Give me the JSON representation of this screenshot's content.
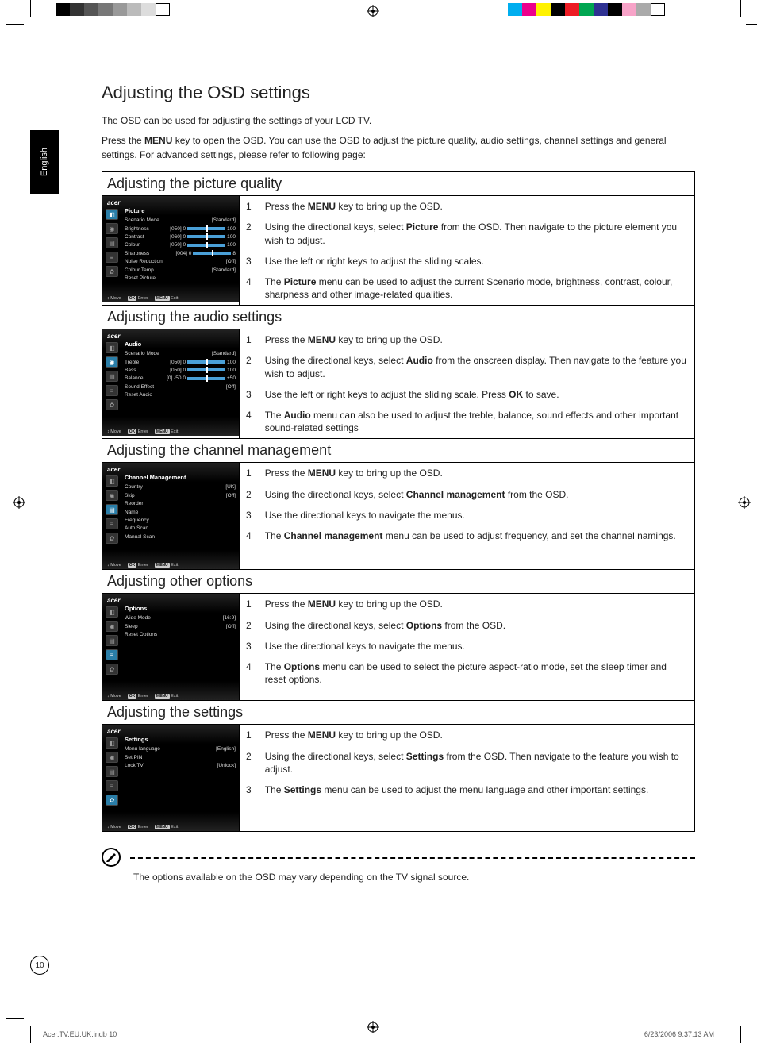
{
  "language_tab": "English",
  "page_title": "Adjusting the OSD settings",
  "intro": {
    "p1": "The OSD can be used for adjusting the settings of your LCD TV.",
    "p2_pre": "Press the ",
    "p2_key": "MENU",
    "p2_post": " key to open the OSD. You can use the OSD to adjust the picture quality, audio settings, channel settings and general settings. For advanced settings, please refer to following page:"
  },
  "sections": [
    {
      "heading": "Adjusting the picture quality",
      "osd": {
        "title": "Picture",
        "active_icon": 0,
        "rows": [
          {
            "lbl": "Scenario Mode",
            "val": "[Standard]"
          },
          {
            "lbl": "Brightness",
            "num": "[050]",
            "slider": true,
            "end": "100"
          },
          {
            "lbl": "Contrast",
            "num": "[060]",
            "slider": true,
            "end": "100"
          },
          {
            "lbl": "Colour",
            "num": "[050]",
            "slider": true,
            "end": "100"
          },
          {
            "lbl": "Sharpness",
            "num": "[004]",
            "slider": true,
            "end": "8"
          },
          {
            "lbl": "Noise Reduction",
            "val": "[Off]"
          },
          {
            "lbl": "Colour Temp.",
            "val": "[Standard]"
          },
          {
            "lbl": "Reset Picture",
            "val": ""
          }
        ]
      },
      "steps": [
        {
          "n": "1",
          "pre": "Press the ",
          "b": "MENU",
          "post": " key to bring up the OSD."
        },
        {
          "n": "2",
          "pre": "Using the directional keys, select ",
          "b": "Picture",
          "post": " from the OSD. Then navigate to the picture element you wish to adjust."
        },
        {
          "n": "3",
          "pre": "Use the left or right keys to adjust the sliding scales.",
          "b": "",
          "post": ""
        },
        {
          "n": "4",
          "pre": "The ",
          "b": "Picture",
          "post": " menu can be used to adjust the current Scenario mode, brightness, contrast, colour, sharpness and other image-related qualities."
        }
      ]
    },
    {
      "heading": "Adjusting the audio settings",
      "osd": {
        "title": "Audio",
        "active_icon": 1,
        "rows": [
          {
            "lbl": "Scenario Mode",
            "val": "[Standard]"
          },
          {
            "lbl": "Treble",
            "num": "[050]",
            "slider": true,
            "end": "100"
          },
          {
            "lbl": "Bass",
            "num": "[050]",
            "slider": true,
            "end": "100"
          },
          {
            "lbl": "Balance",
            "num": "[0]  -50",
            "slider": true,
            "end": "+50"
          },
          {
            "lbl": "Sound Effect",
            "val": "[Off]"
          },
          {
            "lbl": "Reset Audio",
            "val": ""
          }
        ]
      },
      "steps": [
        {
          "n": "1",
          "pre": "Press the ",
          "b": "MENU",
          "post": " key to bring up the OSD."
        },
        {
          "n": "2",
          "pre": "Using the directional keys, select ",
          "b": "Audio",
          "post": " from the onscreen display. Then navigate to the feature you wish to adjust."
        },
        {
          "n": "3",
          "pre": "Use the left or right keys to adjust the sliding scale. Press ",
          "b": "OK",
          "post": " to save."
        },
        {
          "n": "4",
          "pre": "The ",
          "b": "Audio",
          "post": " menu can also be used to adjust the treble, balance, sound effects and other important sound-related settings"
        }
      ]
    },
    {
      "heading": "Adjusting the channel management",
      "osd": {
        "title": "Channel Management",
        "active_icon": 2,
        "rows": [
          {
            "lbl": "Country",
            "val": "[UK]"
          },
          {
            "lbl": "Skip",
            "val": "[Off]"
          },
          {
            "lbl": "Reorder",
            "val": ""
          },
          {
            "lbl": "Name",
            "val": ""
          },
          {
            "lbl": "Frequency",
            "val": ""
          },
          {
            "lbl": "Auto Scan",
            "val": ""
          },
          {
            "lbl": "Manual Scan",
            "val": ""
          }
        ]
      },
      "steps": [
        {
          "n": "1",
          "pre": "Press the ",
          "b": "MENU",
          "post": " key to bring up the OSD."
        },
        {
          "n": "2",
          "pre": "Using the directional keys, select ",
          "b": "Channel management",
          "post": " from the OSD."
        },
        {
          "n": "3",
          "pre": "Use the directional keys to navigate the menus.",
          "b": "",
          "post": ""
        },
        {
          "n": "4",
          "pre": "The ",
          "b": "Channel management",
          "post": " menu can be used to adjust frequency, and set the channel namings."
        }
      ]
    },
    {
      "heading": "Adjusting other options",
      "osd": {
        "title": "Options",
        "active_icon": 3,
        "rows": [
          {
            "lbl": "Wide Mode",
            "val": "[16:9]"
          },
          {
            "lbl": "Sleep",
            "val": "[Off]"
          },
          {
            "lbl": "Reset Options",
            "val": ""
          }
        ]
      },
      "steps": [
        {
          "n": "1",
          "pre": "Press the ",
          "b": "MENU",
          "post": " key to bring up the OSD."
        },
        {
          "n": "2",
          "pre": "Using the directional keys, select ",
          "b": "Options",
          "post": " from the OSD."
        },
        {
          "n": "3",
          "pre": "Use the directional keys to navigate the menus.",
          "b": "",
          "post": ""
        },
        {
          "n": "4",
          "pre": "The ",
          "b": "Options",
          "post": " menu can be used to select the picture aspect-ratio mode, set the sleep timer and reset options."
        }
      ]
    },
    {
      "heading": "Adjusting the settings",
      "osd": {
        "title": "Settings",
        "active_icon": 4,
        "rows": [
          {
            "lbl": "Menu language",
            "val": "[English]"
          },
          {
            "lbl": "Set PIN",
            "val": ""
          },
          {
            "lbl": "Lock TV",
            "val": "[Unlock]"
          }
        ]
      },
      "steps": [
        {
          "n": "1",
          "pre": "Press the ",
          "b": "MENU",
          "post": " key to bring up the OSD."
        },
        {
          "n": "2",
          "pre": "Using the directional keys, select ",
          "b": "Settings",
          "post": " from the OSD. Then navigate to the feature you wish to adjust."
        },
        {
          "n": "3",
          "pre": "The ",
          "b": "Settings",
          "post": " menu can be used to adjust the menu language and other important settings."
        }
      ]
    }
  ],
  "osd_footer": {
    "move": "Move",
    "enter": "Enter",
    "exit": "Exit",
    "exit_key": "MENU",
    "enter_key": "OK"
  },
  "osd_brand": "acer",
  "sidebar_glyphs": [
    "◧",
    "◉",
    "▤",
    "≡",
    "✿"
  ],
  "note_text": "The options available on the OSD may vary depending on the TV signal source.",
  "page_number": "10",
  "imprint_left": "Acer.TV.EU.UK.indb   10",
  "imprint_right": "6/23/2006   9:37:13 AM",
  "colorbars": {
    "left": [
      "#000",
      "#333",
      "#555",
      "#777",
      "#999",
      "#bbb",
      "#ddd",
      "#fff"
    ],
    "right": [
      "#00aeef",
      "#ec008c",
      "#fff200",
      "#000",
      "#ed1c24",
      "#00a651",
      "#2e3192",
      "#000",
      "#f7a3c8",
      "#aaa",
      "#fff"
    ]
  }
}
